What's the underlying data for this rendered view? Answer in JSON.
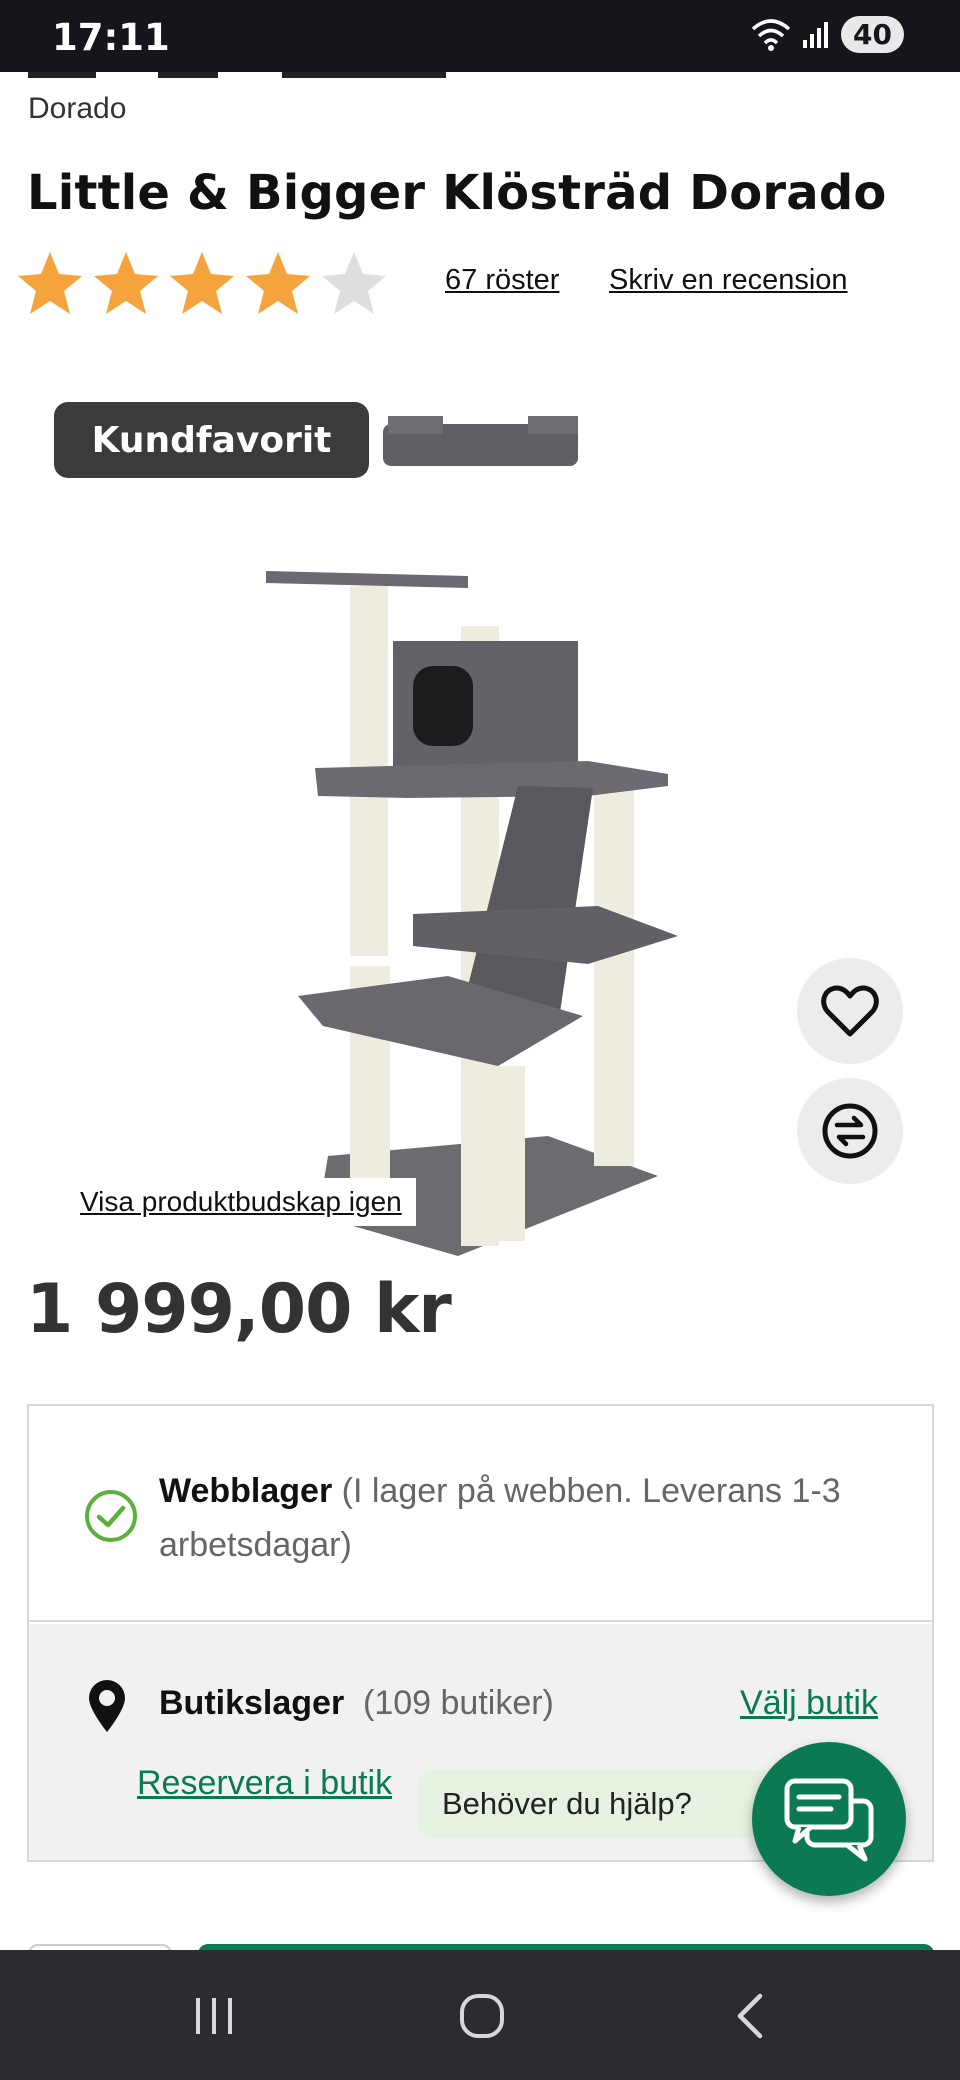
{
  "status_bar": {
    "time": "17:11",
    "battery": "40",
    "wifi_icon": "wifi-icon",
    "signal_icon": "signal-icon"
  },
  "breadcrumb": {
    "current": "Dorado"
  },
  "product": {
    "title": "Little & Bigger Klösträd Dorado",
    "rating": 4,
    "rating_max": 5,
    "votes_label": "67 röster",
    "review_label": "Skriv en recension",
    "badge": "Kundfavorit",
    "show_message_link": "Visa produktbudskap igen",
    "price": "1 999,00 kr"
  },
  "stock": {
    "web": {
      "label": "Webblager",
      "detail": "(I lager på webben. Leverans 1-3 arbetsdagar)"
    },
    "store": {
      "label": "Butikslager",
      "count": "(109 butiker)",
      "choose_label": "Välj butik",
      "reserve_label": "Reservera i butik"
    }
  },
  "help": {
    "bubble_text": "Behöver du hjälp?"
  },
  "colors": {
    "accent": "#0b7a52",
    "star": "#f5a33c",
    "star_empty": "#dedede",
    "badge_bg": "#3b3b3b"
  },
  "icons": {
    "favorite": "heart-icon",
    "compare": "compare-icon",
    "chat": "chat-icon",
    "check": "check-circle-icon",
    "pin": "location-pin-icon"
  },
  "nav": {
    "recent": "recent-apps-icon",
    "home": "home-icon",
    "back": "back-icon"
  }
}
